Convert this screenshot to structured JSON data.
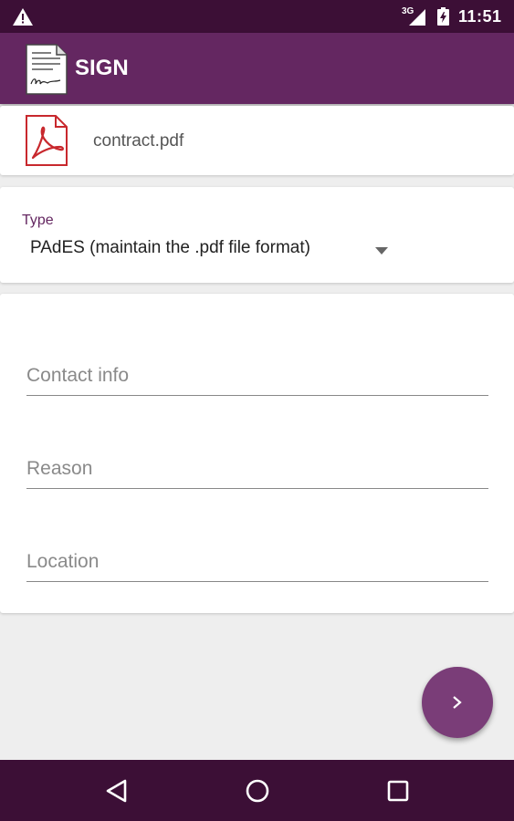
{
  "status_bar": {
    "network": "3G",
    "time": "11:51",
    "icons": [
      "warning-icon",
      "signal-icon",
      "battery-icon"
    ]
  },
  "app_bar": {
    "title": "SIGN",
    "logo_icon": "signed-document-icon"
  },
  "file": {
    "name": "contract.pdf",
    "icon": "pdf-icon"
  },
  "type": {
    "label": "Type",
    "selected": "PAdES (maintain the .pdf file format)"
  },
  "form": {
    "contact_placeholder": "Contact info",
    "reason_placeholder": "Reason",
    "location_placeholder": "Location"
  },
  "fab": {
    "icon": "chevron-right-icon"
  },
  "nav": {
    "icons": [
      "back-icon",
      "home-icon",
      "recents-icon"
    ]
  },
  "colors": {
    "app_bar": "#642761",
    "status_bar": "#3c0f36",
    "fab": "#7a3d78",
    "accent": "#642761",
    "pdf_red": "#c8282d"
  }
}
